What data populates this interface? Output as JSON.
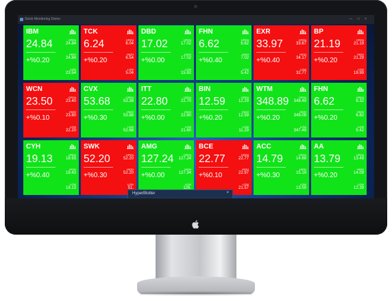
{
  "window": {
    "title": "Stock Monitoring Demo",
    "controls": "— □ ×"
  },
  "colors": {
    "up": "#11e319",
    "down": "#f40f10"
  },
  "tiles": [
    {
      "symbol": "IBM",
      "price": "24.84",
      "change": "+%0.20",
      "open": "24.84",
      "high": "24.84",
      "low": "23.54",
      "dir": "up"
    },
    {
      "symbol": "TCK",
      "price": "6.24",
      "change": "+%0.20",
      "open": "6.04",
      "high": "6.54",
      "low": "5.04",
      "dir": "down"
    },
    {
      "symbol": "DBD",
      "price": "17.02",
      "change": "+%0.00",
      "open": "17.02",
      "high": "17.02",
      "low": "15.92",
      "dir": "up"
    },
    {
      "symbol": "FHN",
      "price": "6.62",
      "change": "+%0.40",
      "open": "6.62",
      "high": "7.02",
      "low": "5.42",
      "dir": "up"
    },
    {
      "symbol": "EXR",
      "price": "33.97",
      "change": "+%0.40",
      "open": "33.67",
      "high": "34.17",
      "low": "32.77",
      "dir": "down"
    },
    {
      "symbol": "BP",
      "price": "21.19",
      "change": "+%0.20",
      "open": "21.19",
      "high": "21.29",
      "low": "19.99",
      "dir": "down"
    },
    {
      "symbol": "WCN",
      "price": "23.50",
      "change": "+%0.10",
      "open": "23.40",
      "high": "23.80",
      "low": "22.20",
      "dir": "down"
    },
    {
      "symbol": "CVX",
      "price": "53.68",
      "change": "+%0.30",
      "open": "53.38",
      "high": "53.88",
      "low": "52.68",
      "dir": "up"
    },
    {
      "symbol": "ITT",
      "price": "22.80",
      "change": "+%0.00",
      "open": "22.70",
      "high": "22.80",
      "low": "21.60",
      "dir": "up"
    },
    {
      "symbol": "BIN",
      "price": "12.59",
      "change": "+%0.20",
      "open": "12.29",
      "high": "12.59",
      "low": "11.29",
      "dir": "up"
    },
    {
      "symbol": "WTM",
      "price": "348.89",
      "change": "+%0.20",
      "open": "348.49",
      "high": "349.09",
      "low": "347.49",
      "dir": "up"
    },
    {
      "symbol": "FHN",
      "price": "6.62",
      "change": "+%0.20",
      "open": "6.32",
      "high": "6.82",
      "low": "5.42",
      "dir": "up"
    },
    {
      "symbol": "CYH",
      "price": "19.13",
      "change": "+%0.40",
      "open": "18.93",
      "high": "19.43",
      "low": "18.13",
      "dir": "up"
    },
    {
      "symbol": "SWK",
      "price": "52.20",
      "change": "+%0.30",
      "open": "52.20",
      "high": "52.20",
      "low": "51.",
      "dir": "down"
    },
    {
      "symbol": "AMG",
      "price": "127.24",
      "change": "+%0.00",
      "open": "127.24",
      "high": "127.34",
      "low": "126.",
      "dir": "up"
    },
    {
      "symbol": "BCE",
      "price": "22.77",
      "change": "+%0.10",
      "open": "22.77",
      "high": "22.97",
      "low": "21.57",
      "dir": "down"
    },
    {
      "symbol": "ACC",
      "price": "14.79",
      "change": "+%0.30",
      "open": "14.69",
      "high": "15.19",
      "low": "13.59",
      "dir": "up"
    },
    {
      "symbol": "AA",
      "price": "13.79",
      "change": "+%0.20",
      "open": "13.49",
      "high": "14.09",
      "low": "12.39",
      "dir": "up"
    }
  ],
  "labels": {
    "open": "OPEN",
    "high": "HIGH",
    "low": "LOW"
  },
  "toolbar": {
    "title": "HyperBlotter",
    "close": "×",
    "buttons": [
      "sort-icon",
      "play-icon",
      "grid-icon",
      "excel-icon",
      "github-icon"
    ]
  }
}
